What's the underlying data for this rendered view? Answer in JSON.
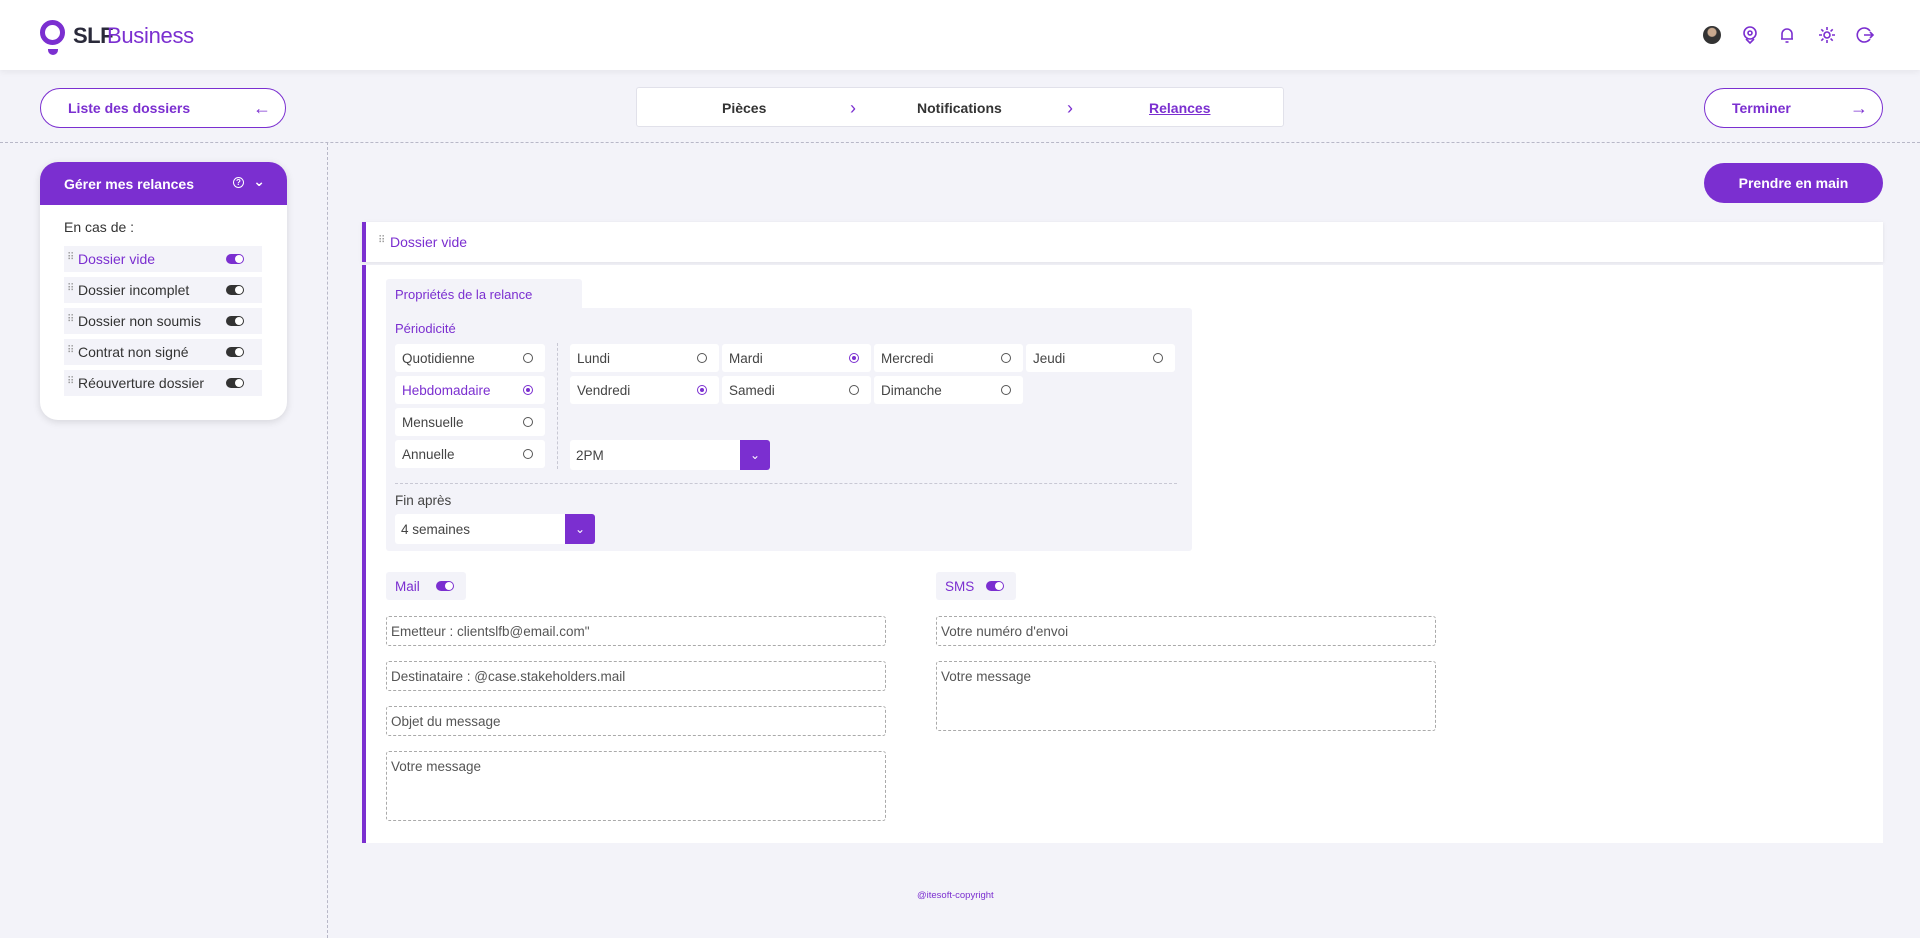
{
  "header": {
    "logo_slf": "SLF",
    "logo_business": "Business",
    "icons": [
      "avatar",
      "location-icon",
      "bell-icon",
      "gear-icon",
      "logout-icon"
    ]
  },
  "nav": {
    "back_label": "Liste des dossiers",
    "back_arrow": "←",
    "finish_label": "Terminer",
    "finish_arrow": "→",
    "steps": [
      {
        "label": "Pièces",
        "active": false
      },
      {
        "label": "Notifications",
        "active": false
      },
      {
        "label": "Relances",
        "active": true
      }
    ]
  },
  "sidebar": {
    "title": "Gérer mes relances",
    "in_case_label": "En cas de :",
    "items": [
      {
        "label": "Dossier vide",
        "enabled": true
      },
      {
        "label": "Dossier incomplet",
        "enabled": false
      },
      {
        "label": "Dossier non soumis",
        "enabled": false
      },
      {
        "label": "Contrat non signé",
        "enabled": false
      },
      {
        "label": "Réouverture dossier",
        "enabled": false
      }
    ]
  },
  "main": {
    "take_button": "Prendre en main",
    "card_title": "Dossier vide",
    "props_tab": "Propriétés de la relance",
    "periodicity_label": "Périodicité",
    "frequencies": [
      {
        "label": "Quotidienne",
        "selected": false
      },
      {
        "label": "Hebdomadaire",
        "selected": true
      },
      {
        "label": "Mensuelle",
        "selected": false
      },
      {
        "label": "Annuelle",
        "selected": false
      }
    ],
    "days": [
      {
        "label": "Lundi",
        "selected": false
      },
      {
        "label": "Mardi",
        "selected": true
      },
      {
        "label": "Mercredi",
        "selected": false
      },
      {
        "label": "Jeudi",
        "selected": false
      },
      {
        "label": "Vendredi",
        "selected": true
      },
      {
        "label": "Samedi",
        "selected": false
      },
      {
        "label": "Dimanche",
        "selected": false
      }
    ],
    "time_value": "2PM",
    "end_after_label": "Fin après",
    "end_after_value": "4 semaines",
    "mail": {
      "label": "Mail",
      "enabled": true,
      "sender": "Emetteur : clientslfb@email.com\"",
      "recipient": "Destinataire : @case.stakeholders.mail",
      "subject_placeholder": "Objet du message",
      "message_placeholder": "Votre message"
    },
    "sms": {
      "label": "SMS",
      "enabled": true,
      "number_placeholder": "Votre numéro d'envoi",
      "message_placeholder": "Votre message"
    }
  },
  "footer": {
    "copyright": "@itesoft-copyright"
  },
  "colors": {
    "accent": "#7b2fd0",
    "background": "#f3f3f9"
  }
}
